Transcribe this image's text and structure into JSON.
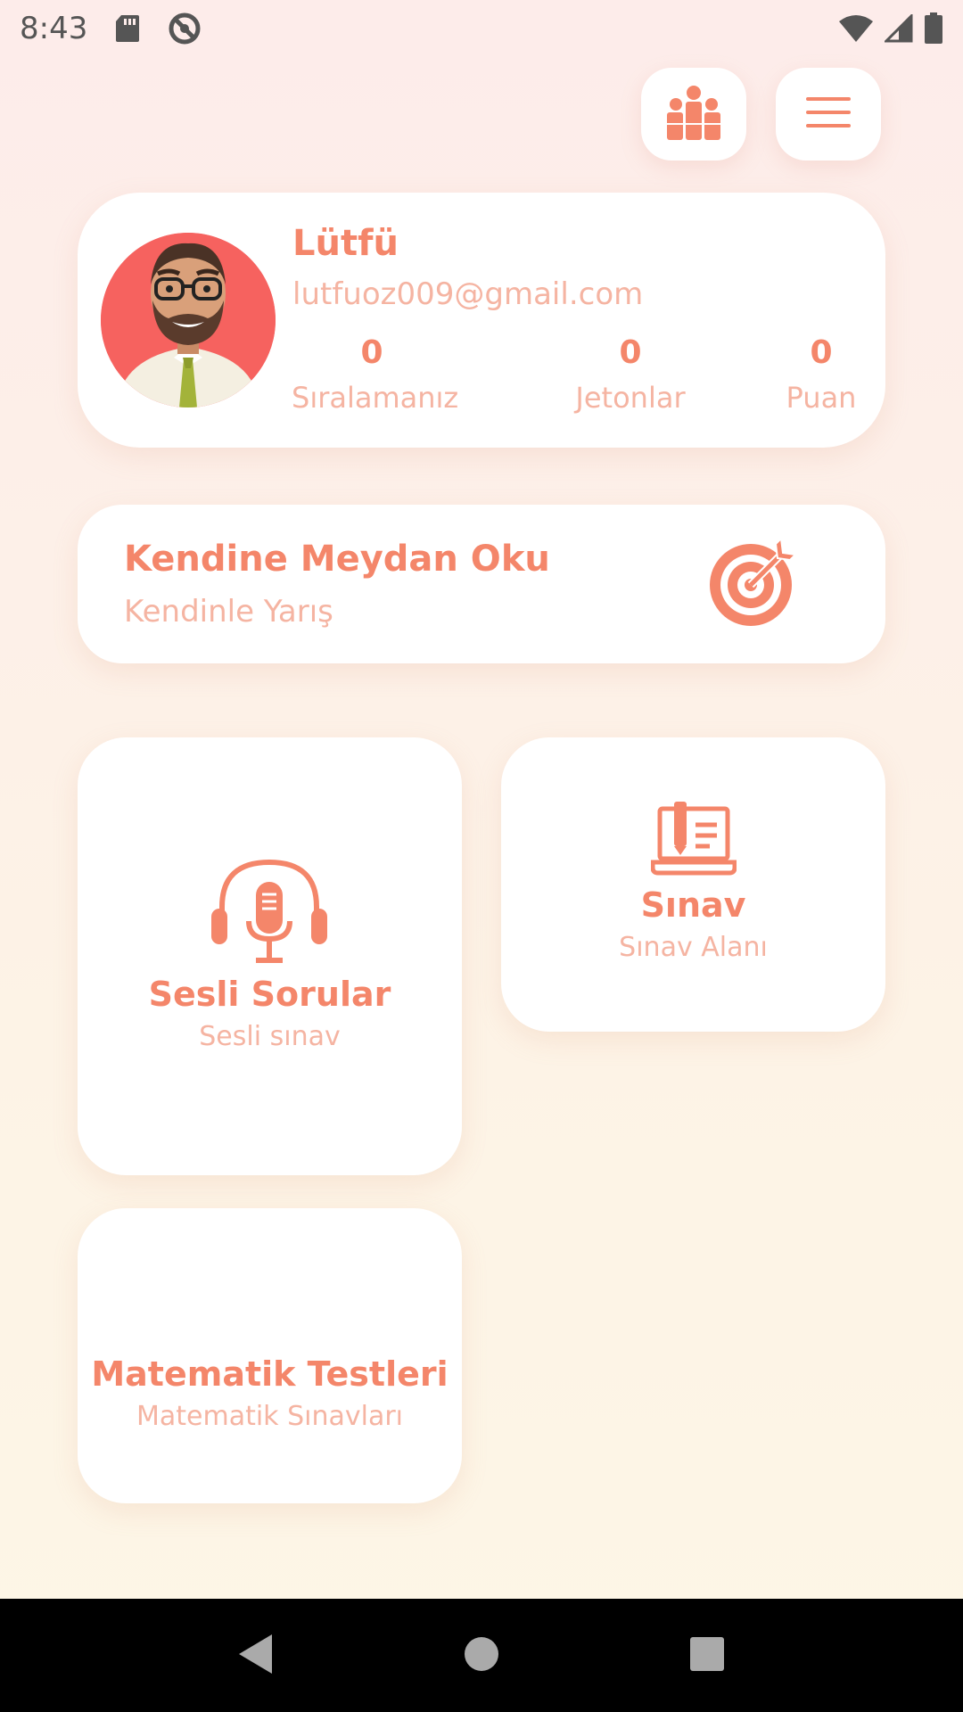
{
  "status_bar": {
    "time": "8:43",
    "left_icons": [
      "sd-card-icon",
      "sync-disabled-icon"
    ],
    "right_icons": [
      "wifi-icon",
      "cell-signal-icon",
      "battery-icon"
    ]
  },
  "top_actions": {
    "leaderboard_icon": "leaderboard-people-icon",
    "menu_icon": "hamburger-menu-icon"
  },
  "profile": {
    "name": "Lütfü",
    "email": "lutfuoz009@gmail.com",
    "avatar_icon": "bearded-man-avatar",
    "stats": [
      {
        "value": "0",
        "label": "Sıralamanız"
      },
      {
        "value": "0",
        "label": "Jetonlar"
      },
      {
        "value": "0",
        "label": "Puan"
      }
    ]
  },
  "challenge": {
    "title": "Kendine Meydan Oku",
    "subtitle": "Kendinle Yarış",
    "icon": "target-arrow-icon"
  },
  "tiles": {
    "voice": {
      "title": "Sesli Sorular",
      "subtitle": "Sesli sınav",
      "icon": "headphones-microphone-icon"
    },
    "exam": {
      "title": "Sınav",
      "subtitle": "Sınav Alanı",
      "icon": "laptop-exam-icon"
    },
    "math": {
      "title": "Matematik Testleri",
      "subtitle": "Matematik Sınavları"
    }
  },
  "nav_bar": {
    "icons": [
      "back-icon",
      "home-icon",
      "recents-icon"
    ]
  },
  "colors": {
    "accent": "#f4866a",
    "accent_light": "#f5b4a2",
    "avatar_bg": "#f6625f",
    "card_bg": "#ffffff"
  }
}
